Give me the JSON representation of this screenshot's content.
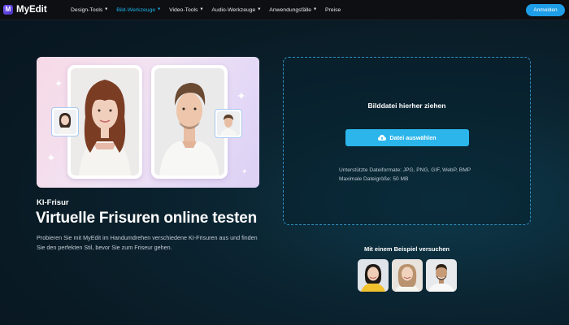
{
  "nav": {
    "brand": "MyEdit",
    "items": [
      {
        "label": "Design-Tools",
        "active": false
      },
      {
        "label": "Bild-Werkzeuge",
        "active": true
      },
      {
        "label": "Video-Tools",
        "active": false
      },
      {
        "label": "Audio-Werkzeuge",
        "active": false
      },
      {
        "label": "Anwendungsfälle",
        "active": false
      },
      {
        "label": "Preise",
        "active": false
      }
    ],
    "login": "Anmelden"
  },
  "hero": {
    "eyebrow": "KI-Frisur",
    "title": "Virtuelle Frisuren online testen",
    "description": "Probieren Sie mit MyEdit im Handumdrehen verschiedene KI-Frisuren aus und finden Sie den perfekten Stil, bevor Sie zum Friseur gehen."
  },
  "upload": {
    "title": "Bilddatei hierher ziehen",
    "button": "Datei auswählen",
    "formats": "Unterstützte Dateiformate: JPG, PNG, GIF, WebP, BMP",
    "max_size": "Maximale Dateigröße: 50 MB"
  },
  "examples": {
    "title": "Mit einem Beispiel versuchen",
    "items": [
      "sample-woman-yellow-shirt",
      "sample-woman-white-shirt",
      "sample-man-white-shirt"
    ]
  },
  "colors": {
    "accent": "#2bb5ea",
    "nav_active": "#1fb2e8",
    "login": "#1e9ee6"
  }
}
